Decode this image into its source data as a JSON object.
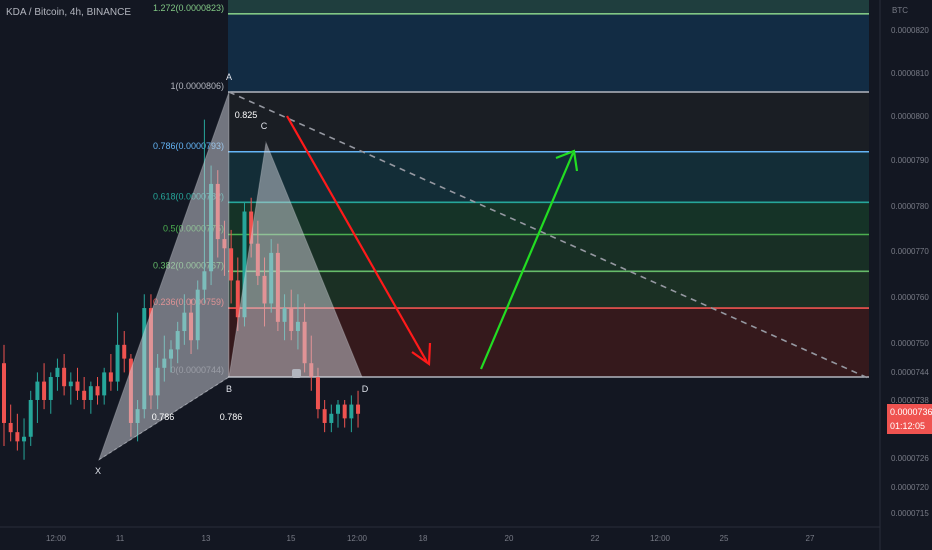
{
  "header": {
    "title": "KDA / Bitcoin, 4h, BINANCE"
  },
  "price_tag": {
    "price": "0.0000736",
    "countdown": "01:12:05"
  },
  "colors": {
    "background": "#131722",
    "up": "#26a69a",
    "down": "#ef5350",
    "arrow_down": "#ff1a1a",
    "arrow_up": "#22dd22",
    "pattern_fill": "#d1d4dc"
  },
  "chart_data": {
    "type": "candlestick",
    "title": "KDA / Bitcoin, 4h, BINANCE",
    "y_axis": {
      "unit_label": "BTC",
      "range": [
        7.13e-05,
        8.28e-05
      ],
      "ticks": [
        "0.0000820",
        "0.0000810",
        "0.0000800",
        "0.0000790",
        "0.0000780",
        "0.0000770",
        "0.0000760",
        "0.0000750",
        "0.0000744",
        "0.0000738",
        "0.0000732",
        "0.0000726",
        "0.0000720",
        "0.0000715"
      ]
    },
    "x_axis": {
      "ticks": [
        "12:00",
        "11",
        "13",
        "15",
        "12:00",
        "18",
        "20",
        "22",
        "12:00",
        "25",
        "27"
      ]
    },
    "fib_levels": [
      {
        "ratio": "1.272",
        "price": 8.23e-05,
        "label": "1.272(0.0000823)",
        "color": "#81c784"
      },
      {
        "ratio": "1",
        "price": 8.06e-05,
        "label": "1(0.0000806)",
        "color": "#b2b5be"
      },
      {
        "ratio": "0.786",
        "price": 7.93e-05,
        "label": "0.786(0.0000793)",
        "color": "#64b5f6"
      },
      {
        "ratio": "0.618",
        "price": 7.82e-05,
        "label": "0.618(0.0000782)",
        "color": "#26a69a"
      },
      {
        "ratio": "0.5",
        "price": 7.75e-05,
        "label": "0.5(0.0000775)",
        "color": "#4caf50"
      },
      {
        "ratio": "0.382",
        "price": 7.67e-05,
        "label": "0.382(0.0000767)",
        "color": "#66bb6a"
      },
      {
        "ratio": "0.236",
        "price": 7.59e-05,
        "label": "0.236(0.0000759)",
        "color": "#ef5350"
      },
      {
        "ratio": "0",
        "price": 7.44e-05,
        "label": "0(0.0000744)",
        "color": "#b2b5be"
      }
    ],
    "pattern": {
      "name": "XABCD",
      "points": [
        {
          "name": "X",
          "price": 7.26e-05
        },
        {
          "name": "A",
          "price": 8.06e-05
        },
        {
          "name": "B",
          "price": 7.44e-05
        },
        {
          "name": "C",
          "price": 7.95e-05
        },
        {
          "name": "D",
          "price": 7.44e-05
        }
      ],
      "ratios": [
        "0.786",
        "0.786",
        "0.825"
      ]
    },
    "candles": [
      {
        "o": 7.47e-05,
        "h": 7.51e-05,
        "l": 7.29e-05,
        "c": 7.34e-05
      },
      {
        "o": 7.34e-05,
        "h": 7.38e-05,
        "l": 7.3e-05,
        "c": 7.32e-05
      },
      {
        "o": 7.32e-05,
        "h": 7.36e-05,
        "l": 7.28e-05,
        "c": 7.3e-05
      },
      {
        "o": 7.3e-05,
        "h": 7.35e-05,
        "l": 7.26e-05,
        "c": 7.31e-05
      },
      {
        "o": 7.31e-05,
        "h": 7.41e-05,
        "l": 7.29e-05,
        "c": 7.39e-05
      },
      {
        "o": 7.39e-05,
        "h": 7.45e-05,
        "l": 7.34e-05,
        "c": 7.43e-05
      },
      {
        "o": 7.43e-05,
        "h": 7.47e-05,
        "l": 7.37e-05,
        "c": 7.39e-05
      },
      {
        "o": 7.39e-05,
        "h": 7.45e-05,
        "l": 7.36e-05,
        "c": 7.44e-05
      },
      {
        "o": 7.44e-05,
        "h": 7.48e-05,
        "l": 7.41e-05,
        "c": 7.46e-05
      },
      {
        "o": 7.46e-05,
        "h": 7.49e-05,
        "l": 7.4e-05,
        "c": 7.42e-05
      },
      {
        "o": 7.42e-05,
        "h": 7.45e-05,
        "l": 7.38e-05,
        "c": 7.43e-05
      },
      {
        "o": 7.43e-05,
        "h": 7.46e-05,
        "l": 7.39e-05,
        "c": 7.41e-05
      },
      {
        "o": 7.41e-05,
        "h": 7.44e-05,
        "l": 7.37e-05,
        "c": 7.39e-05
      },
      {
        "o": 7.39e-05,
        "h": 7.43e-05,
        "l": 7.36e-05,
        "c": 7.42e-05
      },
      {
        "o": 7.42e-05,
        "h": 7.44e-05,
        "l": 7.38e-05,
        "c": 7.4e-05
      },
      {
        "o": 7.4e-05,
        "h": 7.46e-05,
        "l": 7.38e-05,
        "c": 7.45e-05
      },
      {
        "o": 7.45e-05,
        "h": 7.49e-05,
        "l": 7.41e-05,
        "c": 7.43e-05
      },
      {
        "o": 7.43e-05,
        "h": 7.58e-05,
        "l": 7.41e-05,
        "c": 7.51e-05
      },
      {
        "o": 7.51e-05,
        "h": 7.54e-05,
        "l": 7.45e-05,
        "c": 7.48e-05
      },
      {
        "o": 7.48e-05,
        "h": 7.49e-05,
        "l": 7.31e-05,
        "c": 7.34e-05
      },
      {
        "o": 7.34e-05,
        "h": 7.39e-05,
        "l": 7.3e-05,
        "c": 7.37e-05
      },
      {
        "o": 7.37e-05,
        "h": 7.62e-05,
        "l": 7.35e-05,
        "c": 7.59e-05
      },
      {
        "o": 7.59e-05,
        "h": 7.62e-05,
        "l": 7.37e-05,
        "c": 7.4e-05
      },
      {
        "o": 7.4e-05,
        "h": 7.49e-05,
        "l": 7.37e-05,
        "c": 7.46e-05
      },
      {
        "o": 7.46e-05,
        "h": 7.53e-05,
        "l": 7.43e-05,
        "c": 7.48e-05
      },
      {
        "o": 7.48e-05,
        "h": 7.52e-05,
        "l": 7.45e-05,
        "c": 7.5e-05
      },
      {
        "o": 7.5e-05,
        "h": 7.56e-05,
        "l": 7.47e-05,
        "c": 7.54e-05
      },
      {
        "o": 7.54e-05,
        "h": 7.62e-05,
        "l": 7.51e-05,
        "c": 7.58e-05
      },
      {
        "o": 7.58e-05,
        "h": 7.61e-05,
        "l": 7.49e-05,
        "c": 7.52e-05
      },
      {
        "o": 7.52e-05,
        "h": 7.65e-05,
        "l": 7.5e-05,
        "c": 7.63e-05
      },
      {
        "o": 7.63e-05,
        "h": 8e-05,
        "l": 7.6e-05,
        "c": 7.67e-05
      },
      {
        "o": 7.67e-05,
        "h": 7.9e-05,
        "l": 7.64e-05,
        "c": 7.86e-05
      },
      {
        "o": 7.86e-05,
        "h": 7.89e-05,
        "l": 7.7e-05,
        "c": 7.74e-05
      },
      {
        "o": 7.74e-05,
        "h": 7.78e-05,
        "l": 7.66e-05,
        "c": 7.72e-05
      },
      {
        "o": 7.72e-05,
        "h": 7.76e-05,
        "l": 7.6e-05,
        "c": 7.65e-05
      },
      {
        "o": 7.65e-05,
        "h": 7.7e-05,
        "l": 7.54e-05,
        "c": 7.57e-05
      },
      {
        "o": 7.57e-05,
        "h": 7.82e-05,
        "l": 7.55e-05,
        "c": 7.8e-05
      },
      {
        "o": 7.8e-05,
        "h": 7.83e-05,
        "l": 7.7e-05,
        "c": 7.73e-05
      },
      {
        "o": 7.73e-05,
        "h": 7.78e-05,
        "l": 7.64e-05,
        "c": 7.66e-05
      },
      {
        "o": 7.66e-05,
        "h": 7.7e-05,
        "l": 7.55e-05,
        "c": 7.6e-05
      },
      {
        "o": 7.6e-05,
        "h": 7.74e-05,
        "l": 7.58e-05,
        "c": 7.71e-05
      },
      {
        "o": 7.71e-05,
        "h": 7.73e-05,
        "l": 7.54e-05,
        "c": 7.56e-05
      },
      {
        "o": 7.56e-05,
        "h": 7.62e-05,
        "l": 7.52e-05,
        "c": 7.59e-05
      },
      {
        "o": 7.59e-05,
        "h": 7.63e-05,
        "l": 7.52e-05,
        "c": 7.54e-05
      },
      {
        "o": 7.54e-05,
        "h": 7.62e-05,
        "l": 7.5e-05,
        "c": 7.56e-05
      },
      {
        "o": 7.56e-05,
        "h": 7.6e-05,
        "l": 7.45e-05,
        "c": 7.47e-05
      },
      {
        "o": 7.47e-05,
        "h": 7.53e-05,
        "l": 7.41e-05,
        "c": 7.44e-05
      },
      {
        "o": 7.44e-05,
        "h": 7.46e-05,
        "l": 7.35e-05,
        "c": 7.37e-05
      },
      {
        "o": 7.37e-05,
        "h": 7.39e-05,
        "l": 7.32e-05,
        "c": 7.34e-05
      },
      {
        "o": 7.34e-05,
        "h": 7.38e-05,
        "l": 7.32e-05,
        "c": 7.36e-05
      },
      {
        "o": 7.36e-05,
        "h": 7.39e-05,
        "l": 7.33e-05,
        "c": 7.38e-05
      },
      {
        "o": 7.38e-05,
        "h": 7.39e-05,
        "l": 7.33e-05,
        "c": 7.35e-05
      },
      {
        "o": 7.35e-05,
        "h": 7.4e-05,
        "l": 7.32e-05,
        "c": 7.38e-05
      },
      {
        "o": 7.38e-05,
        "h": 7.41e-05,
        "l": 7.33e-05,
        "c": 7.36e-05
      }
    ]
  }
}
